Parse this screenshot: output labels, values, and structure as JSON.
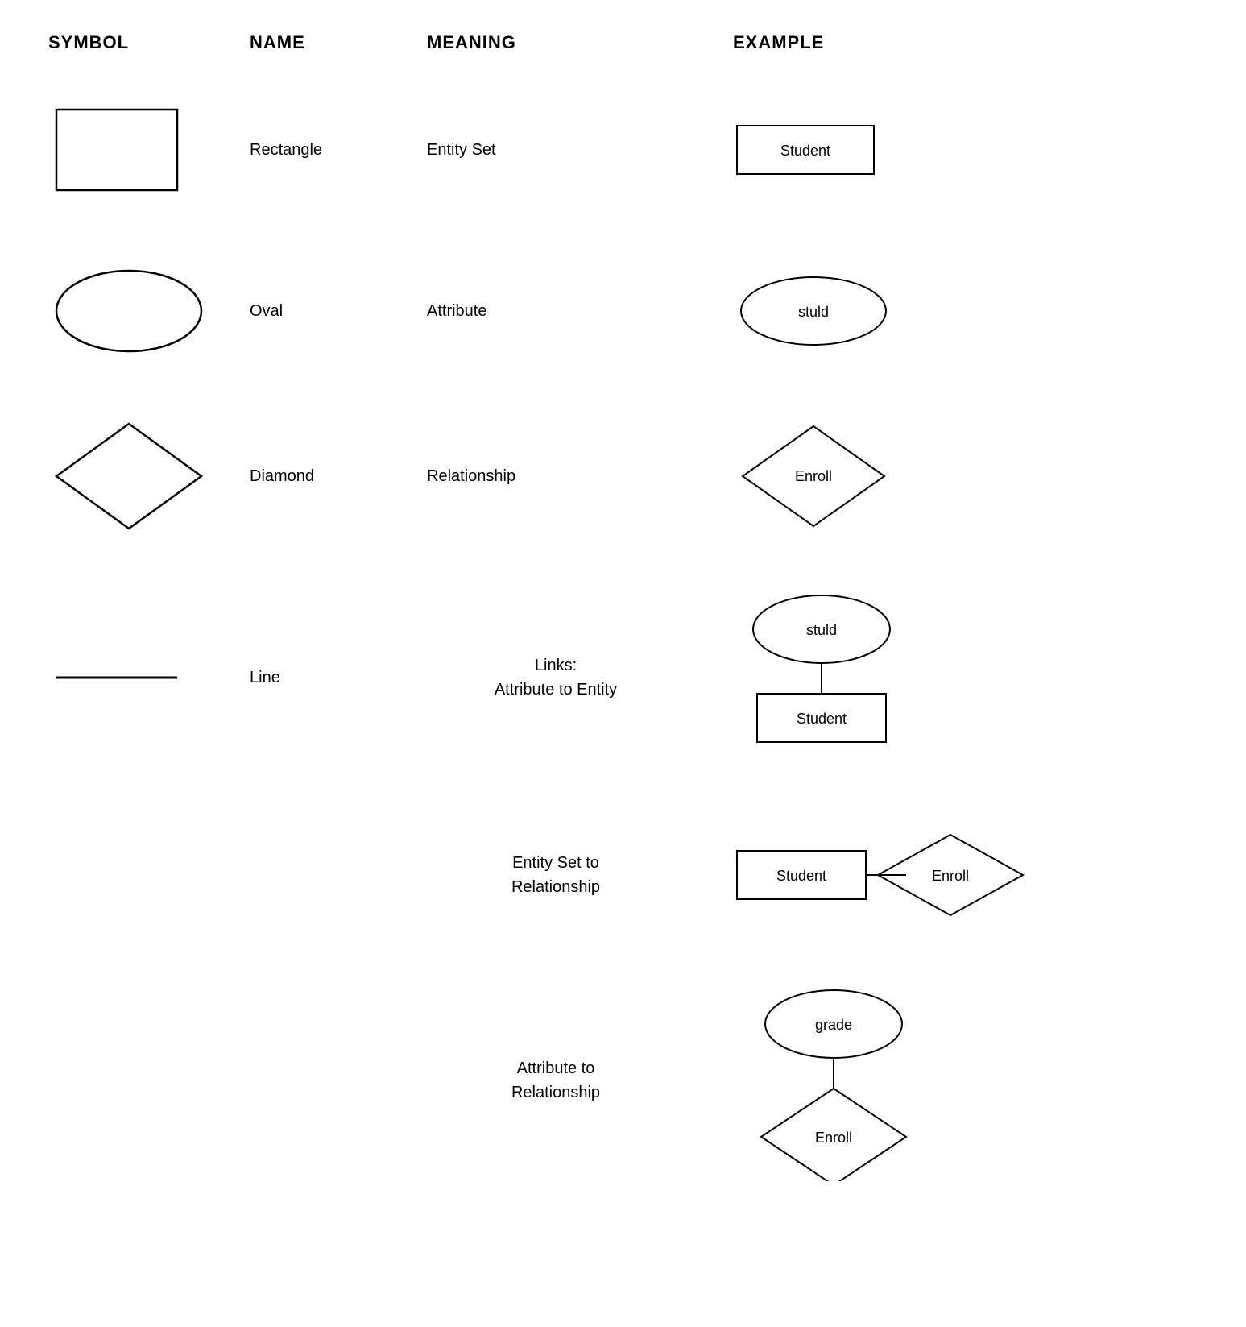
{
  "headers": {
    "symbol": "SYMBOL",
    "name": "NAME",
    "meaning": "MEANING",
    "example": "EXAMPLE"
  },
  "rows": [
    {
      "id": "rectangle",
      "name": "Rectangle",
      "meaning": "Entity Set",
      "example_label": "Student"
    },
    {
      "id": "oval",
      "name": "Oval",
      "meaning": "Attribute",
      "example_label": "stuld"
    },
    {
      "id": "diamond",
      "name": "Diamond",
      "meaning": "Relationship",
      "example_label": "Enroll"
    },
    {
      "id": "line",
      "name": "Line",
      "meaning_line1": "Links:",
      "meaning_line2": "Attribute to Entity",
      "example_oval": "stuld",
      "example_rect": "Student"
    }
  ],
  "extra_rows": [
    {
      "id": "entity-to-relationship",
      "meaning_line1": "Entity Set to",
      "meaning_line2": "Relationship",
      "entity_label": "Student",
      "relationship_label": "Enroll"
    },
    {
      "id": "attribute-to-relationship",
      "meaning_line1": "Attribute to",
      "meaning_line2": "Relationship",
      "attribute_label": "grade",
      "relationship_label": "Enroll"
    }
  ]
}
